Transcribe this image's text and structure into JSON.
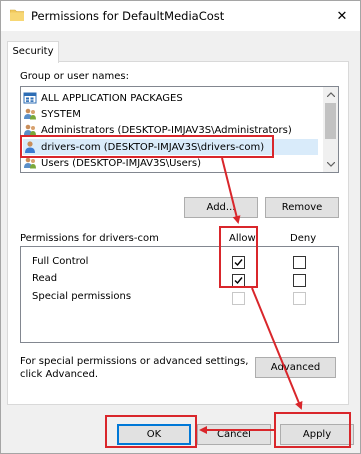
{
  "window": {
    "title": "Permissions for DefaultMediaCost",
    "close_glyph": "✕"
  },
  "tabs": [
    {
      "label": "Security",
      "active": true
    }
  ],
  "group": {
    "label": "Group or user names:",
    "items": [
      {
        "label": "ALL APPLICATION PACKAGES",
        "icon": "packages-icon",
        "selected": false
      },
      {
        "label": "SYSTEM",
        "icon": "users-icon",
        "selected": false
      },
      {
        "label": "Administrators (DESKTOP-IMJAV3S\\Administrators)",
        "icon": "users-icon",
        "selected": false
      },
      {
        "label": "drivers-com (DESKTOP-IMJAV3S\\drivers-com)",
        "icon": "user-icon",
        "selected": true
      },
      {
        "label": "Users (DESKTOP-IMJAV3S\\Users)",
        "icon": "users-icon",
        "selected": false
      }
    ]
  },
  "buttons": {
    "add": "Add...",
    "remove": "Remove",
    "advanced": "Advanced",
    "ok": "OK",
    "cancel": "Cancel",
    "apply": "Apply"
  },
  "permissions": {
    "label": "Permissions for drivers-com",
    "allow_header": "Allow",
    "deny_header": "Deny",
    "rows": [
      {
        "name": "Full Control",
        "allow": true,
        "deny": false,
        "enabled": true
      },
      {
        "name": "Read",
        "allow": true,
        "deny": false,
        "enabled": true
      },
      {
        "name": "Special permissions",
        "allow": false,
        "deny": false,
        "enabled": false
      }
    ]
  },
  "advanced_note": {
    "line1": "For special permissions or advanced settings,",
    "line2": "click Advanced."
  },
  "colors": {
    "annotation": "#d9262b",
    "selection": "#d9ebfa",
    "default_button_border": "#0078d7",
    "folder": "#f0c95c"
  }
}
